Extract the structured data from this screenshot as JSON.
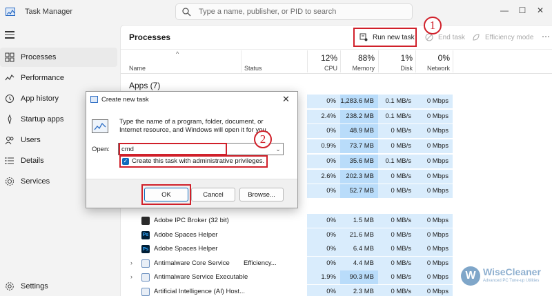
{
  "app": {
    "title": "Task Manager"
  },
  "search": {
    "placeholder": "Type a name, publisher, or PID to search"
  },
  "window_controls": {
    "minimize": "—",
    "maximize": "☐",
    "close": "✕"
  },
  "sidebar": {
    "items": [
      {
        "label": "Processes",
        "icon": "processes-icon"
      },
      {
        "label": "Performance",
        "icon": "performance-icon"
      },
      {
        "label": "App history",
        "icon": "app-history-icon"
      },
      {
        "label": "Startup apps",
        "icon": "startup-apps-icon"
      },
      {
        "label": "Users",
        "icon": "users-icon"
      },
      {
        "label": "Details",
        "icon": "details-icon"
      },
      {
        "label": "Services",
        "icon": "services-icon"
      }
    ],
    "settings": "Settings"
  },
  "main": {
    "title": "Processes",
    "toolbar": {
      "run_new_task": "Run new task",
      "end_task": "End task",
      "efficiency_mode": "Efficiency mode",
      "more": "⋯"
    },
    "columns": {
      "name": "Name",
      "status": "Status",
      "cpu": {
        "label": "CPU",
        "percent": "12%"
      },
      "memory": {
        "label": "Memory",
        "percent": "88%"
      },
      "disk": {
        "label": "Disk",
        "percent": "1%"
      },
      "network": {
        "label": "Network",
        "percent": "0%"
      }
    },
    "apps_group": "Apps (7)",
    "app_rows": [
      {
        "cpu": "0%",
        "memory": "1,283.6 MB",
        "disk": "0.1 MB/s",
        "network": "0 Mbps"
      },
      {
        "cpu": "2.4%",
        "memory": "238.2 MB",
        "disk": "0.1 MB/s",
        "network": "0 Mbps"
      },
      {
        "cpu": "0%",
        "memory": "48.9 MB",
        "disk": "0 MB/s",
        "network": "0 Mbps"
      },
      {
        "cpu": "0.9%",
        "memory": "73.7 MB",
        "disk": "0 MB/s",
        "network": "0 Mbps"
      },
      {
        "cpu": "0%",
        "memory": "35.6 MB",
        "disk": "0.1 MB/s",
        "network": "0 Mbps"
      },
      {
        "cpu": "2.6%",
        "memory": "202.3 MB",
        "disk": "0 MB/s",
        "network": "0 Mbps"
      },
      {
        "cpu": "0%",
        "memory": "52.7 MB",
        "disk": "0 MB/s",
        "network": "0 Mbps"
      }
    ],
    "bg_rows": [
      {
        "name": "Adobe IPC Broker (32 bit)",
        "status": "",
        "cpu": "0%",
        "memory": "1.5 MB",
        "disk": "0 MB/s",
        "network": "0 Mbps",
        "icon": "adobe-icon",
        "expandable": false
      },
      {
        "name": "Adobe Spaces Helper",
        "status": "",
        "cpu": "0%",
        "memory": "21.6 MB",
        "disk": "0 MB/s",
        "network": "0 Mbps",
        "icon": "photoshop-icon",
        "expandable": false
      },
      {
        "name": "Adobe Spaces Helper",
        "status": "",
        "cpu": "0%",
        "memory": "6.4 MB",
        "disk": "0 MB/s",
        "network": "0 Mbps",
        "icon": "photoshop-icon",
        "expandable": false
      },
      {
        "name": "Antimalware Core Service",
        "status": "Efficiency...",
        "cpu": "0%",
        "memory": "4.4 MB",
        "disk": "0 MB/s",
        "network": "0 Mbps",
        "icon": "service-icon",
        "expandable": true
      },
      {
        "name": "Antimalware Service Executable",
        "status": "",
        "cpu": "1.9%",
        "memory": "90.3 MB",
        "disk": "0 MB/s",
        "network": "0 Mbps",
        "icon": "service-icon",
        "expandable": true
      },
      {
        "name": "Artificial Intelligence (AI) Host...",
        "status": "",
        "cpu": "0%",
        "memory": "2.3 MB",
        "disk": "0 MB/s",
        "network": "0 Mbps",
        "icon": "service-icon",
        "expandable": false
      }
    ]
  },
  "dialog": {
    "title": "Create new task",
    "close": "✕",
    "description": "Type the name of a program, folder, document, or Internet resource, and Windows will open it for you.",
    "open_label": "Open:",
    "open_value": "cmd",
    "admin_checkbox_label": "Create this task with administrative privileges.",
    "admin_checked": true,
    "ok": "OK",
    "cancel": "Cancel",
    "browse": "Browse..."
  },
  "annotations": {
    "step1": "1",
    "step2": "2"
  },
  "watermark": {
    "name": "WiseCleaner",
    "tagline": "Advanced PC Tune-up Utilities",
    "logo": "W"
  },
  "colors": {
    "accent": "#0f6cbd",
    "highlight_border": "#d0202a",
    "usage_fill": "#d9ecfc"
  }
}
